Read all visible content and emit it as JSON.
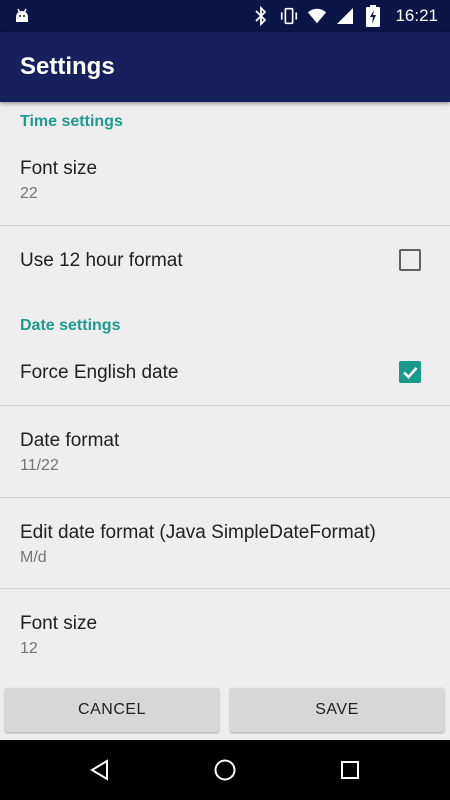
{
  "status_bar": {
    "time": "16:21",
    "icons": [
      "android-debug-icon",
      "bluetooth-icon",
      "vibrate-icon",
      "wifi-icon",
      "signal-icon",
      "battery-charging-icon"
    ]
  },
  "app_bar": {
    "title": "Settings"
  },
  "sections": {
    "time": {
      "header": "Time settings",
      "font_size": {
        "title": "Font size",
        "summary": "22"
      },
      "hour_format": {
        "title": "Use 12 hour format",
        "checked": false
      }
    },
    "date": {
      "header": "Date settings",
      "force_english": {
        "title": "Force English date",
        "checked": true
      },
      "date_format": {
        "title": "Date format",
        "summary": "11/22"
      },
      "edit_date_format": {
        "title": "Edit date format (Java SimpleDateFormat)",
        "summary": "M/d"
      },
      "font_size": {
        "title": "Font size",
        "summary": "12"
      }
    }
  },
  "buttons": {
    "cancel": "CANCEL",
    "save": "SAVE"
  },
  "colors": {
    "accent": "#1e9a8e",
    "app_bar": "#15205c",
    "status_bar": "#0b1648"
  }
}
